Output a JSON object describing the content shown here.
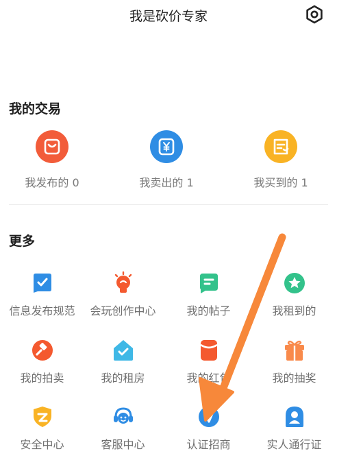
{
  "header": {
    "title": "我是砍价专家",
    "settings_icon": "settings-hexagon-icon"
  },
  "trades": {
    "title": "我的交易",
    "items": [
      {
        "label": "我发布的 0",
        "icon": "shopping-bag-icon",
        "color": "#F25C3A"
      },
      {
        "label": "我卖出的 1",
        "icon": "yuan-wallet-icon",
        "color": "#2F8DE4"
      },
      {
        "label": "我买到的 1",
        "icon": "receipt-icon",
        "color": "#F9B324"
      }
    ]
  },
  "more": {
    "title": "更多",
    "items": [
      {
        "label": "信息发布规范",
        "icon": "check-flag-icon",
        "color": "#2F8DE4"
      },
      {
        "label": "会玩创作中心",
        "icon": "lightbulb-icon",
        "color": "#F4592F"
      },
      {
        "label": "我的帖子",
        "icon": "post-icon",
        "color": "#33C28B"
      },
      {
        "label": "我租到的",
        "icon": "star-badge-icon",
        "color": "#33C28B"
      },
      {
        "label": "我的拍卖",
        "icon": "auction-hammer-icon",
        "color": "#F4592F"
      },
      {
        "label": "我的租房",
        "icon": "house-check-icon",
        "color": "#3FB8E6"
      },
      {
        "label": "我的红包",
        "icon": "red-envelope-icon",
        "color": "#F4592F"
      },
      {
        "label": "我的抽奖",
        "icon": "gift-box-icon",
        "color": "#F98A4B"
      },
      {
        "label": "安全中心",
        "icon": "shield-icon",
        "color": "#F9B324"
      },
      {
        "label": "客服中心",
        "icon": "headset-icon",
        "color": "#2F8DE4"
      },
      {
        "label": "认证招商",
        "icon": "verified-v-icon",
        "color": "#2F8DE4"
      },
      {
        "label": "实人通行证",
        "icon": "person-id-icon",
        "color": "#2F8DE4"
      }
    ]
  },
  "annotation": {
    "arrow_icon": "orange-pointer-arrow-icon",
    "color": "#F7883A"
  }
}
